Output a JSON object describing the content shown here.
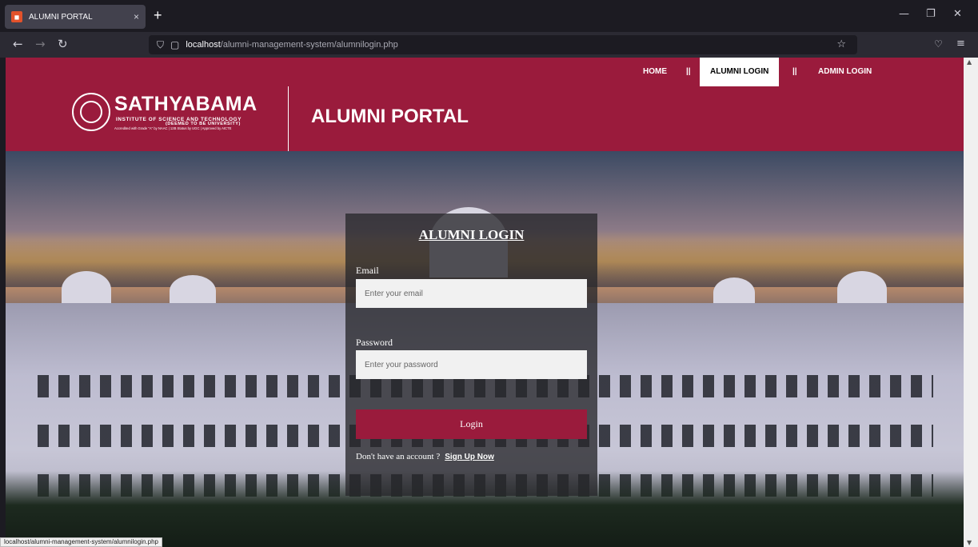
{
  "browser": {
    "tab_title": "ALUMNI PORTAL",
    "tab_close": "×",
    "new_tab": "+",
    "url_host": "localhost",
    "url_path": "/alumni-management-system/alumnilogin.php",
    "status_url": "localhost/alumni-management-system/alumnilogin.php",
    "icons": [
      "back-arrow-icon",
      "forward-arrow-icon",
      "reload-icon",
      "shield-icon",
      "page-icon",
      "star-icon",
      "pocket-icon",
      "menu-icon"
    ]
  },
  "nav": {
    "home": "HOME",
    "separator": "||",
    "alumni_login": "ALUMNI LOGIN",
    "admin_login": "ADMIN LOGIN"
  },
  "header": {
    "logo_title": "SATHYABAMA",
    "logo_sub1": "INSTITUTE OF SCIENCE AND TECHNOLOGY",
    "logo_sub2": "(DEEMED TO BE UNIVERSITY)",
    "logo_sub3": "Accredited with Grade \"A\" by NAAC | 12B Status by UGC | Approved by AICTE",
    "portal_title": "ALUMNI PORTAL"
  },
  "login": {
    "title": "ALUMNI LOGIN",
    "email_label": "Email",
    "email_placeholder": "Enter your email",
    "password_label": "Password",
    "password_placeholder": "Enter your password",
    "button": "Login",
    "signup_prompt": "Don't have an account ?",
    "signup_link": "Sign Up Now"
  },
  "colors": {
    "brand": "#9a1b3c",
    "active_nav_bg": "#ffffff"
  }
}
